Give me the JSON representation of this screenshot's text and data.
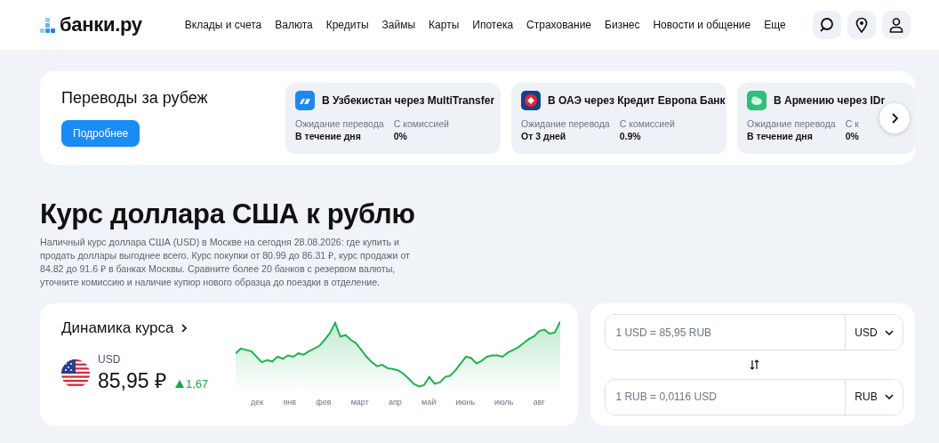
{
  "header": {
    "logo": "банки.ру",
    "nav": [
      "Вклады и счета",
      "Валюта",
      "Кредиты",
      "Займы",
      "Карты",
      "Ипотека",
      "Страхование",
      "Бизнес",
      "Новости и общение",
      "Еще"
    ]
  },
  "transfers": {
    "title": "Переводы за рубеж",
    "button": "Подробнее",
    "cards": [
      {
        "kind": "arrows",
        "title": "В Узбекистан через MultiTransfer",
        "wait_label": "Ожидание перевода",
        "wait_value": "В течение дня",
        "fee_label": "С комиссией",
        "fee_value": "0%"
      },
      {
        "kind": "diamond",
        "title": "В ОАЭ через Кредит Европа Банк",
        "wait_label": "Ожидание перевода",
        "wait_value": "От 3 дней",
        "fee_label": "С комиссией",
        "fee_value": "0.9%"
      },
      {
        "kind": "leaf",
        "title": "В Армению через IDr",
        "wait_label": "Ожидание перевода",
        "wait_value": "В течение дня",
        "fee_label": "С к",
        "fee_value": "0%"
      }
    ]
  },
  "intro": {
    "title": "Курс доллара США к рублю",
    "text": "Наличный курс доллара США (USD) в Москве на сегодня 28.08.2026: где купить и продать доллары выгоднее всего. Курс покупки от 80.99 до 86.31 ₽, курс продажи от 84.82 до 91.6 ₽ в банках Москвы. Сравните более 20 банков с резервом валюты, уточните комиссию и наличие купюр нового образца до поездки в отделение."
  },
  "rate": {
    "title": "Динамика курса",
    "currency": "USD",
    "value": "85,95 ₽",
    "change": {
      "kind": "up",
      "text": "1,67"
    },
    "months": [
      "дек",
      "янв",
      "фев",
      "март",
      "апр",
      "май",
      "июнь",
      "июль",
      "авг"
    ]
  },
  "converter": {
    "rows": [
      {
        "placeholder": "1 USD = 85,95 RUB",
        "currency": "USD"
      },
      {
        "placeholder": "1 RUB = 0,0116 USD",
        "currency": "RUB"
      }
    ]
  }
}
